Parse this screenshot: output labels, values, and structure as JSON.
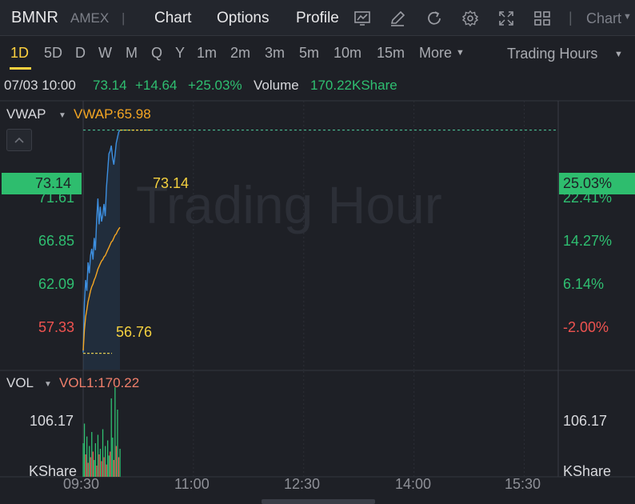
{
  "header": {
    "ticker": "BMNR",
    "exchange": "AMEX",
    "separator": "|",
    "tabs": [
      "Chart",
      "Options",
      "Profile"
    ],
    "active_tab": "Chart",
    "toolbar_icons": [
      "indicator-chart-icon",
      "draw-pencil-icon",
      "refresh-icon",
      "settings-gear-icon",
      "fullscreen-icon",
      "layout-grid-icon"
    ],
    "chart_type_label": "Chart"
  },
  "periods": [
    "1D",
    "5D",
    "D",
    "W",
    "M",
    "Q",
    "Y",
    "1m",
    "2m",
    "3m",
    "5m",
    "10m",
    "15m"
  ],
  "active_period": "1D",
  "more_label": "More",
  "trading_hours_label": "Trading Hours",
  "info": {
    "datetime": "07/03 10:00",
    "price": "73.14",
    "change": "+14.64",
    "change_pct": "+25.03%",
    "volume_label": "Volume",
    "volume_value": "170.22KShare"
  },
  "main_indicator": {
    "name": "VWAP",
    "value_text": "VWAP:65.98"
  },
  "price_axis": {
    "current_price": "73.14",
    "current_pct": "25.03%",
    "left_labels": [
      "71.61",
      "66.85",
      "62.09",
      "57.33"
    ],
    "right_labels": [
      "22.41%",
      "14.27%",
      "6.14%",
      "-2.00%"
    ],
    "high_marker": "73.14",
    "low_marker": "56.76"
  },
  "watermark": "Trading Hour",
  "volume_panel": {
    "name": "VOL",
    "value_text": "VOL1:170.22",
    "left_label": "106.17",
    "right_label": "106.17",
    "unit_left": "KShare",
    "unit_right": "KShare"
  },
  "time_axis": [
    "09:30",
    "11:00",
    "12:30",
    "14:00",
    "15:30"
  ],
  "colors": {
    "up": "#2fbf71",
    "down": "#ef5350",
    "price_line": "#3d8fe0",
    "vwap_line": "#f5a623",
    "marker": "#f4d03f",
    "background": "#1e2026"
  },
  "chart_data": {
    "type": "line",
    "x": [
      "09:30",
      "09:31",
      "09:32",
      "09:33",
      "09:34",
      "09:35",
      "09:36",
      "09:37",
      "09:38",
      "09:39",
      "09:40",
      "09:41",
      "09:42",
      "09:43",
      "09:44",
      "09:45",
      "09:46",
      "09:47",
      "09:48",
      "09:49",
      "09:50",
      "09:51",
      "09:52",
      "09:53",
      "09:54",
      "09:55",
      "09:56",
      "09:57",
      "09:58",
      "09:59",
      "10:00"
    ],
    "series": [
      {
        "values": [
          56.76,
          60.4,
          62.1,
          61.3,
          63.4,
          62.6,
          63.9,
          64.4,
          63.6,
          65.2,
          64.3,
          66.6,
          68.1,
          66.2,
          67.5,
          66.4,
          66.9,
          67.7,
          66.8,
          68.9,
          70.1,
          71.4,
          71.6,
          72.0,
          71.1,
          70.6,
          71.3,
          72.2,
          72.6,
          73.0,
          73.14
        ]
      },
      {
        "name": "VWAP",
        "values": [
          56.9,
          58.4,
          59.4,
          59.9,
          60.5,
          60.9,
          61.3,
          61.6,
          61.8,
          62.1,
          62.3,
          62.6,
          62.9,
          63.1,
          63.3,
          63.5,
          63.6,
          63.8,
          63.9,
          64.1,
          64.3,
          64.5,
          64.7,
          64.9,
          65.0,
          65.2,
          65.4,
          65.5,
          65.7,
          65.85,
          65.98
        ]
      }
    ],
    "volume": {
      "unit": "KShare",
      "values": [
        60,
        95,
        40,
        72,
        25,
        55,
        35,
        80,
        45,
        30,
        60,
        20,
        75,
        40,
        50,
        28,
        85,
        35,
        55,
        22,
        65,
        38,
        45,
        140,
        70,
        30,
        160,
        55,
        120,
        35,
        50
      ],
      "up": [
        true,
        true,
        false,
        true,
        false,
        true,
        false,
        true,
        false,
        true,
        true,
        false,
        true,
        false,
        true,
        false,
        true,
        false,
        true,
        false,
        true,
        true,
        false,
        true,
        true,
        false,
        true,
        false,
        true,
        false,
        true
      ]
    },
    "x_ticks": [
      "09:30",
      "11:00",
      "12:30",
      "14:00",
      "15:30"
    ],
    "y_ticks": [
      57.33,
      62.09,
      66.85,
      71.61
    ],
    "ylim": [
      55.5,
      75.3
    ],
    "volume_ylim": [
      0,
      180
    ],
    "grid": true,
    "reference_price": 58.5
  }
}
